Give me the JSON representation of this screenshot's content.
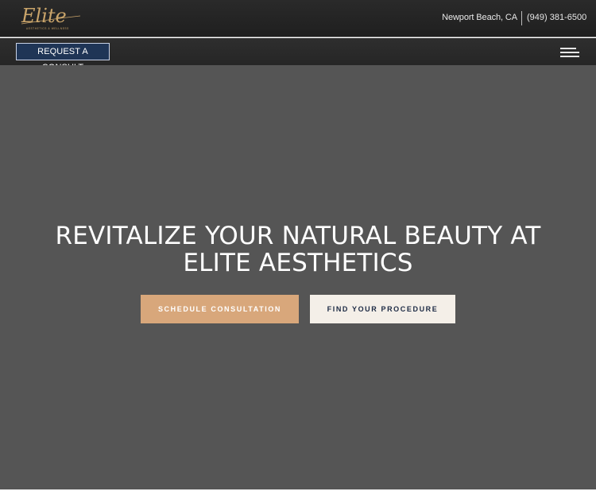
{
  "header": {
    "logo_text": "Elite",
    "logo_tagline": "AESTHETICS & WELLNESS",
    "location": "Newport Beach, CA",
    "phone": "(949) 381-6500"
  },
  "nav": {
    "consult_label": "REQUEST A CONSULT",
    "menu_icon": "hamburger-menu-icon"
  },
  "hero": {
    "title_line1": "REVITALIZE YOUR NATURAL BEAUTY AT",
    "title_line2": "ELITE AESTHETICS",
    "schedule_label": "SCHEDULE CONSULTATION",
    "find_label": "FIND YOUR PROCEDURE"
  },
  "colors": {
    "header_bg": "#222222",
    "hero_bg": "#555555",
    "accent_tan": "#d8a77b",
    "consult_navy": "#1f3556",
    "cream": "#f4efe8",
    "logo_gold": "#c9a46a"
  }
}
